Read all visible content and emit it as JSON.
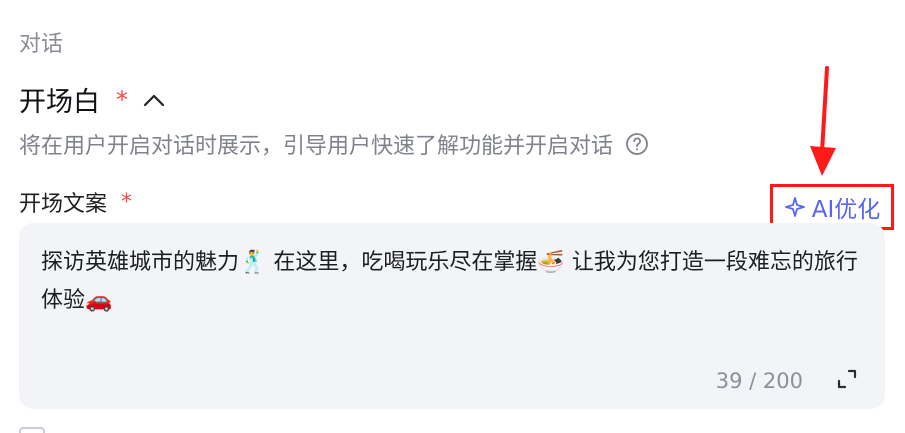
{
  "section": {
    "label": "对话"
  },
  "opening": {
    "title": "开场白",
    "required_mark": "*",
    "description": "将在用户开启对话时展示，引导用户快速了解功能并开启对话",
    "copy_label": "开场文案",
    "copy_required_mark": "*",
    "ai_button_label": "AI优化",
    "text_part1": "探访英雄城市的魅力",
    "emoji1": "🕺",
    "text_part2": " 在这里，吃喝玩乐尽在掌握",
    "emoji2": "🍜",
    "text_part3": " 让我为您打造一段难忘的旅行体验",
    "emoji3": "🚗",
    "char_count": "39 / 200"
  },
  "colors": {
    "accent": "#5965f0",
    "required": "#f54a45",
    "highlight_box": "#ff1a1a",
    "textarea_bg": "#f3f4f8"
  },
  "icons": {
    "collapse": "chevron-up-icon",
    "help": "question-circle-icon",
    "ai": "sparkle-icon",
    "expand": "expand-icon"
  }
}
